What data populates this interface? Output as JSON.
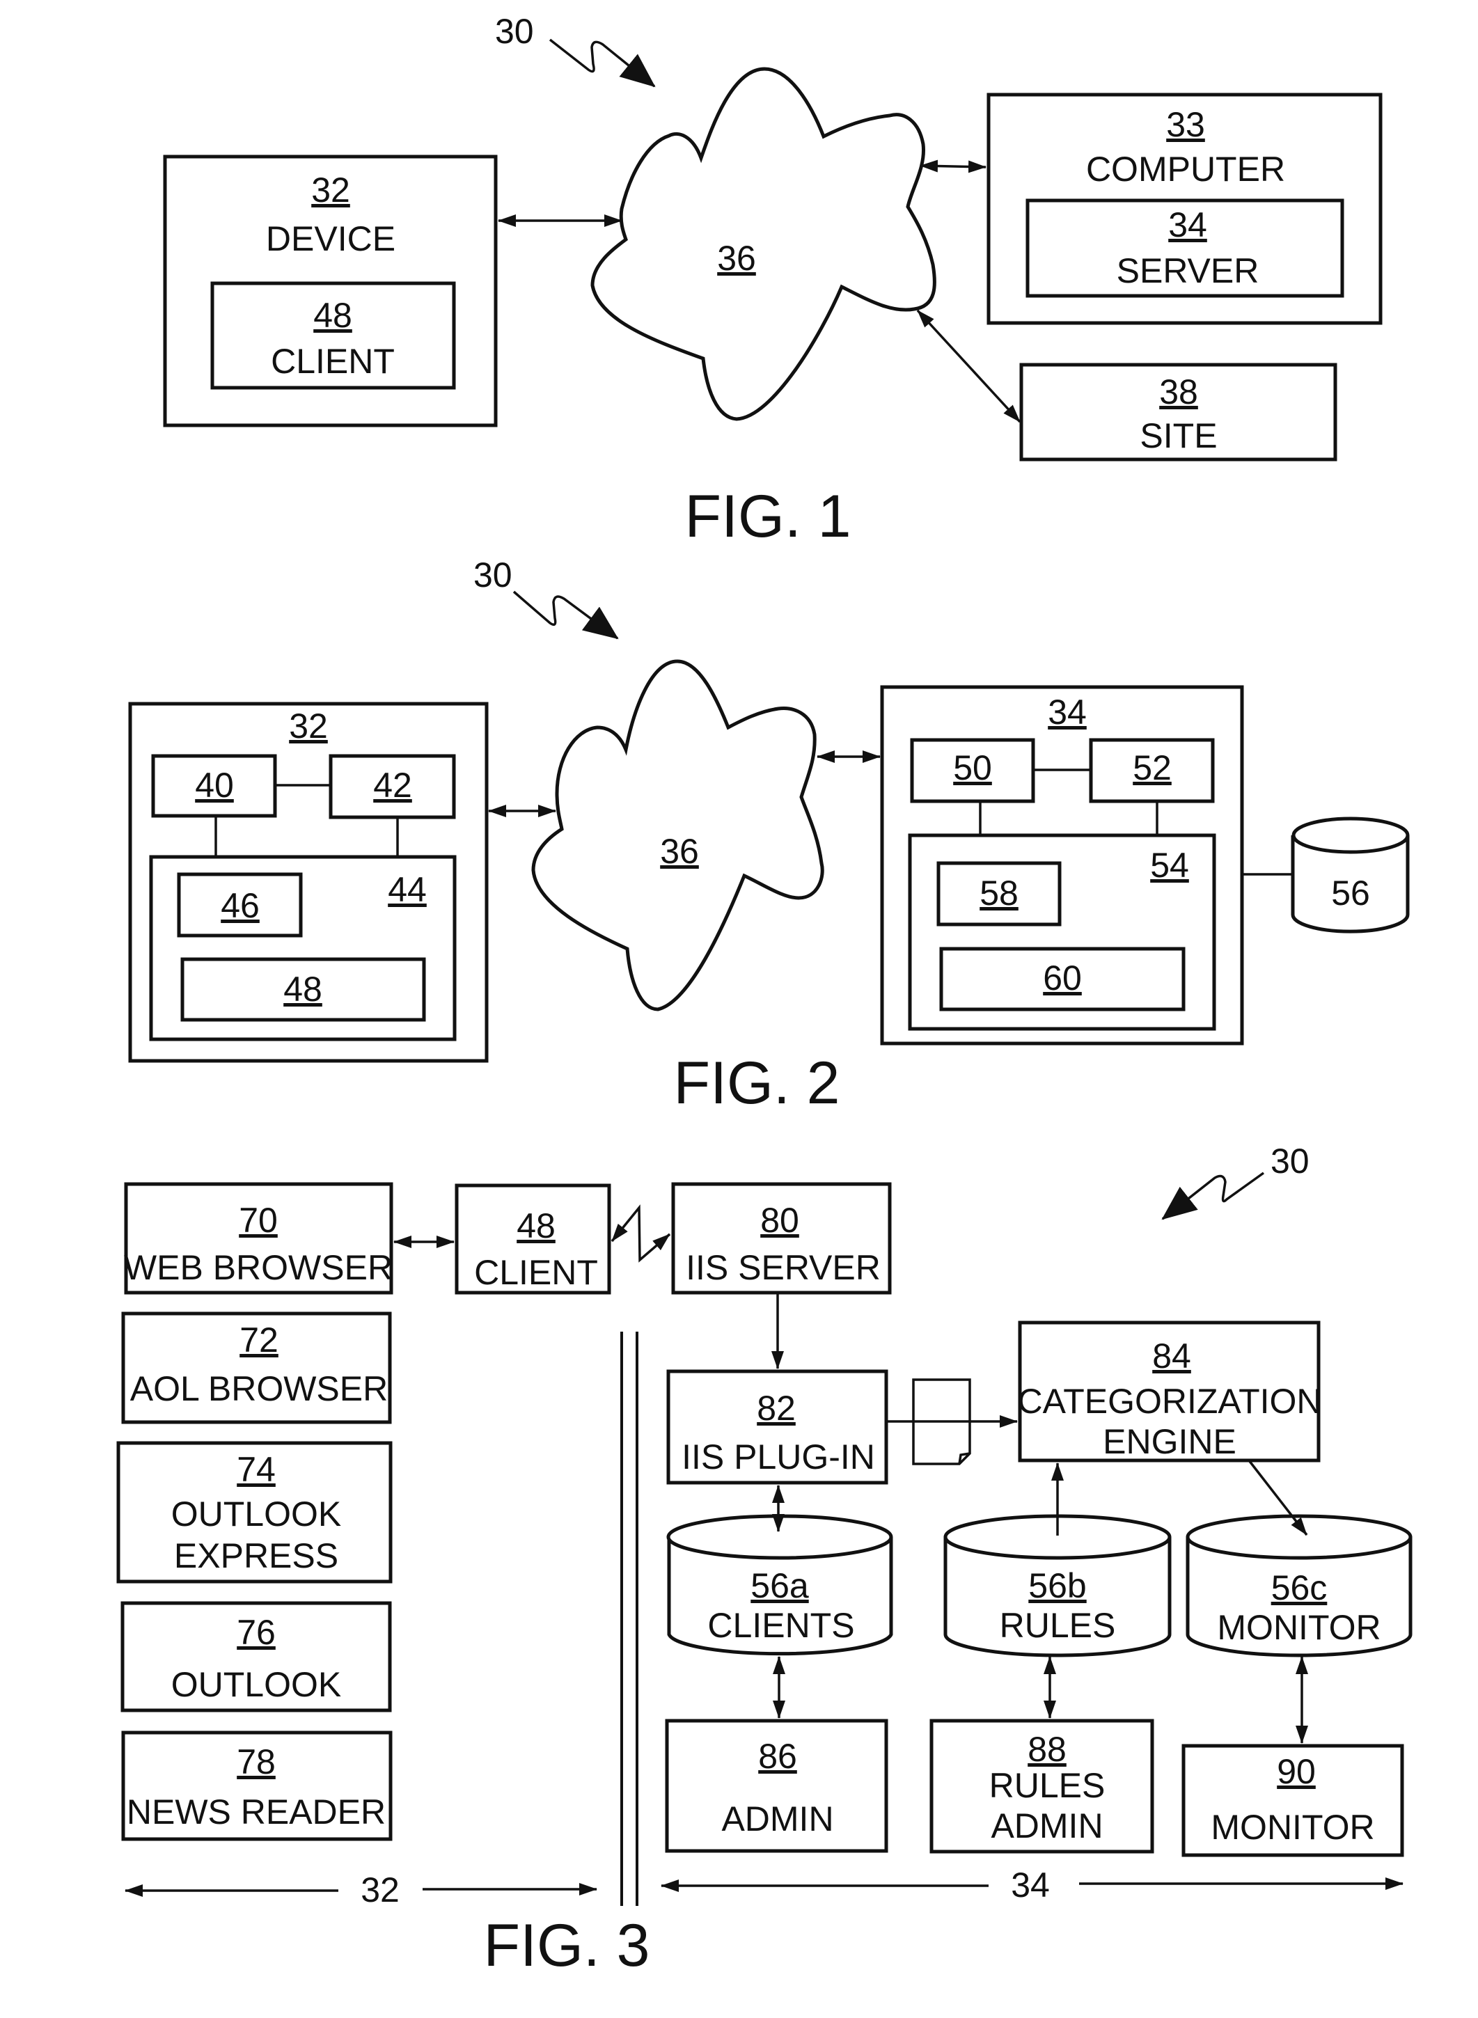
{
  "figures": {
    "fig1": {
      "caption": "FIG. 1",
      "system_ref": "30",
      "network": {
        "ref": "36"
      },
      "device": {
        "ref": "32",
        "label": "DEVICE"
      },
      "client": {
        "ref": "48",
        "label": "CLIENT"
      },
      "computer": {
        "ref": "33",
        "label": "COMPUTER"
      },
      "server": {
        "ref": "34",
        "label": "SERVER"
      },
      "site": {
        "ref": "38",
        "label": "SITE"
      }
    },
    "fig2": {
      "caption": "FIG. 2",
      "system_ref": "30",
      "network": {
        "ref": "36"
      },
      "device": {
        "ref": "32"
      },
      "c40": {
        "ref": "40"
      },
      "c42": {
        "ref": "42"
      },
      "c44": {
        "ref": "44"
      },
      "c46": {
        "ref": "46"
      },
      "c48": {
        "ref": "48"
      },
      "server": {
        "ref": "34"
      },
      "c50": {
        "ref": "50"
      },
      "c52": {
        "ref": "52"
      },
      "c54": {
        "ref": "54"
      },
      "c58": {
        "ref": "58"
      },
      "c60": {
        "ref": "60"
      },
      "database": {
        "ref": "56"
      }
    },
    "fig3": {
      "caption": "FIG. 3",
      "system_ref": "30",
      "client_side": [
        {
          "ref": "70",
          "lines": [
            "WEB BROWSER"
          ]
        },
        {
          "ref": "72",
          "lines": [
            "AOL BROWSER"
          ]
        },
        {
          "ref": "74",
          "lines": [
            "OUTLOOK",
            "EXPRESS"
          ]
        },
        {
          "ref": "76",
          "lines": [
            "OUTLOOK"
          ]
        },
        {
          "ref": "78",
          "lines": [
            "NEWS READER"
          ]
        }
      ],
      "client": {
        "ref": "48",
        "label": "CLIENT"
      },
      "iis_server": {
        "ref": "80",
        "label": "IIS SERVER"
      },
      "iis_plugin": {
        "ref": "82",
        "label": "IIS PLUG-IN"
      },
      "engine": {
        "ref": "84",
        "label1": "CATEGORIZATION",
        "label2": "ENGINE"
      },
      "db_clients": {
        "ref": "56a",
        "label": "CLIENTS"
      },
      "db_rules": {
        "ref": "56b",
        "label": "RULES"
      },
      "db_monitor": {
        "ref": "56c",
        "label": "MONITOR"
      },
      "admin": {
        "ref": "86",
        "label": "ADMIN"
      },
      "rules_admin": {
        "ref": "88",
        "label1": "RULES",
        "label2": "ADMIN"
      },
      "monitor": {
        "ref": "90",
        "label": "MONITOR"
      },
      "span_client": "32",
      "span_server": "34"
    }
  }
}
